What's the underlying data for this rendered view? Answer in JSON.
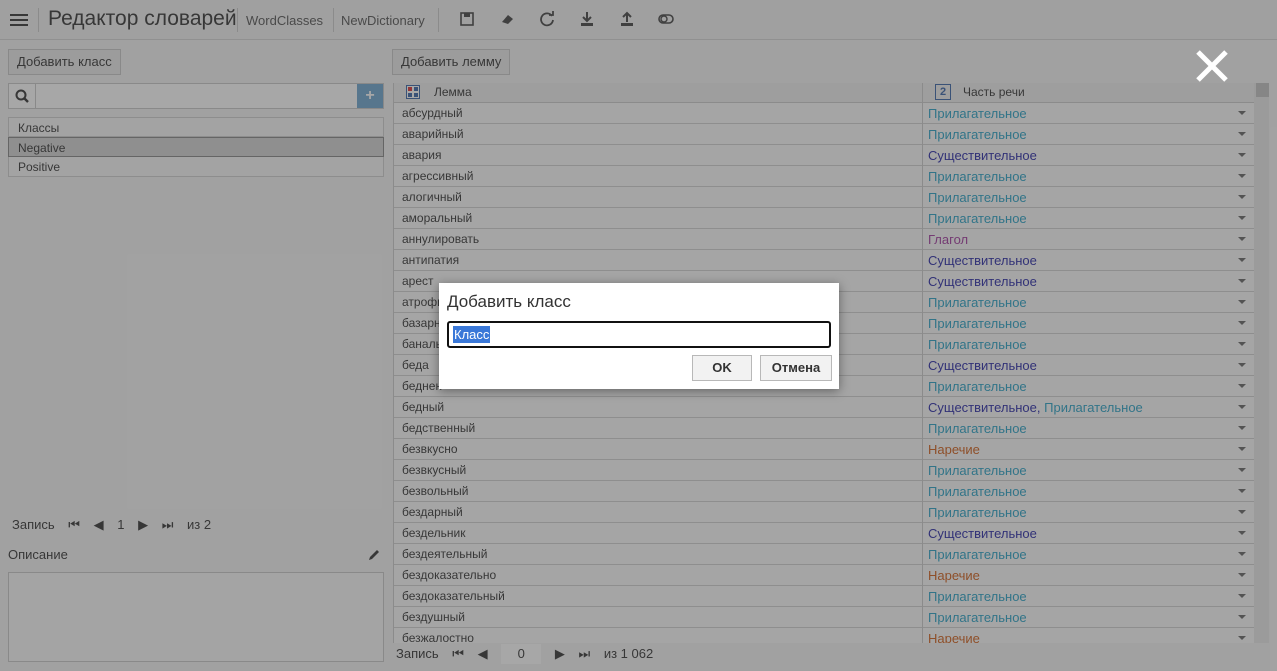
{
  "header": {
    "title": "Редактор словарей",
    "crumbs": [
      "WordClasses",
      "NewDictionary"
    ],
    "toolbar_icons": [
      "save-icon",
      "eraser-icon",
      "refresh-icon",
      "download-icon",
      "upload-icon",
      "toggle-icon"
    ]
  },
  "left": {
    "add_class_label": "Добавить класс",
    "search_placeholder": "",
    "classes_header": "Классы",
    "classes": [
      "Negative",
      "Positive"
    ],
    "pager": {
      "label": "Запись",
      "current": "1",
      "total": "из 2"
    },
    "description_label": "Описание"
  },
  "right": {
    "add_lemma_label": "Добавить лемму",
    "col_lemma": "Лемма",
    "col_pos": "Часть речи",
    "col_pos_badge": "2",
    "rows": [
      {
        "lemma": "абсурдный",
        "pos": [
          [
            "Прилагательное",
            "adj"
          ]
        ]
      },
      {
        "lemma": "аварийный",
        "pos": [
          [
            "Прилагательное",
            "adj"
          ]
        ]
      },
      {
        "lemma": "авария",
        "pos": [
          [
            "Существительное",
            "noun"
          ]
        ]
      },
      {
        "lemma": "агрессивный",
        "pos": [
          [
            "Прилагательное",
            "adj"
          ]
        ]
      },
      {
        "lemma": "алогичный",
        "pos": [
          [
            "Прилагательное",
            "adj"
          ]
        ]
      },
      {
        "lemma": "аморальный",
        "pos": [
          [
            "Прилагательное",
            "adj"
          ]
        ]
      },
      {
        "lemma": "аннулировать",
        "pos": [
          [
            "Глагол",
            "verb"
          ]
        ]
      },
      {
        "lemma": "антипатия",
        "pos": [
          [
            "Существительное",
            "noun"
          ]
        ]
      },
      {
        "lemma": "арест",
        "pos": [
          [
            "Существительное",
            "noun"
          ]
        ]
      },
      {
        "lemma": "атрофи",
        "pos": [
          [
            "Прилагательное",
            "adj"
          ]
        ]
      },
      {
        "lemma": "базарн",
        "pos": [
          [
            "Прилагательное",
            "adj"
          ]
        ]
      },
      {
        "lemma": "банальн",
        "pos": [
          [
            "Прилагательное",
            "adj"
          ]
        ]
      },
      {
        "lemma": "беда",
        "pos": [
          [
            "Существительное",
            "noun"
          ]
        ]
      },
      {
        "lemma": "беднен",
        "pos": [
          [
            "Прилагательное",
            "adj"
          ]
        ]
      },
      {
        "lemma": "бедный",
        "pos": [
          [
            "Существительное, ",
            "noun"
          ],
          [
            "Прилагательное",
            "adj"
          ]
        ]
      },
      {
        "lemma": "бедственный",
        "pos": [
          [
            "Прилагательное",
            "adj"
          ]
        ]
      },
      {
        "lemma": "безвкусно",
        "pos": [
          [
            "Наречие",
            "adv"
          ]
        ]
      },
      {
        "lemma": "безвкусный",
        "pos": [
          [
            "Прилагательное",
            "adj"
          ]
        ]
      },
      {
        "lemma": "безвольный",
        "pos": [
          [
            "Прилагательное",
            "adj"
          ]
        ]
      },
      {
        "lemma": "бездарный",
        "pos": [
          [
            "Прилагательное",
            "adj"
          ]
        ]
      },
      {
        "lemma": "бездельник",
        "pos": [
          [
            "Существительное",
            "noun"
          ]
        ]
      },
      {
        "lemma": "бездеятельный",
        "pos": [
          [
            "Прилагательное",
            "adj"
          ]
        ]
      },
      {
        "lemma": "бездоказательно",
        "pos": [
          [
            "Наречие",
            "adv"
          ]
        ]
      },
      {
        "lemma": "бездоказательный",
        "pos": [
          [
            "Прилагательное",
            "adj"
          ]
        ]
      },
      {
        "lemma": "бездушный",
        "pos": [
          [
            "Прилагательное",
            "adj"
          ]
        ]
      },
      {
        "lemma": "безжалостно",
        "pos": [
          [
            "Наречие",
            "adv"
          ]
        ]
      }
    ],
    "pager": {
      "label": "Запись",
      "current": "0",
      "total": "из 1 062"
    }
  },
  "dialog": {
    "title": "Добавить класс",
    "input_value": "Класс",
    "ok_label": "OK",
    "cancel_label": "Отмена"
  }
}
